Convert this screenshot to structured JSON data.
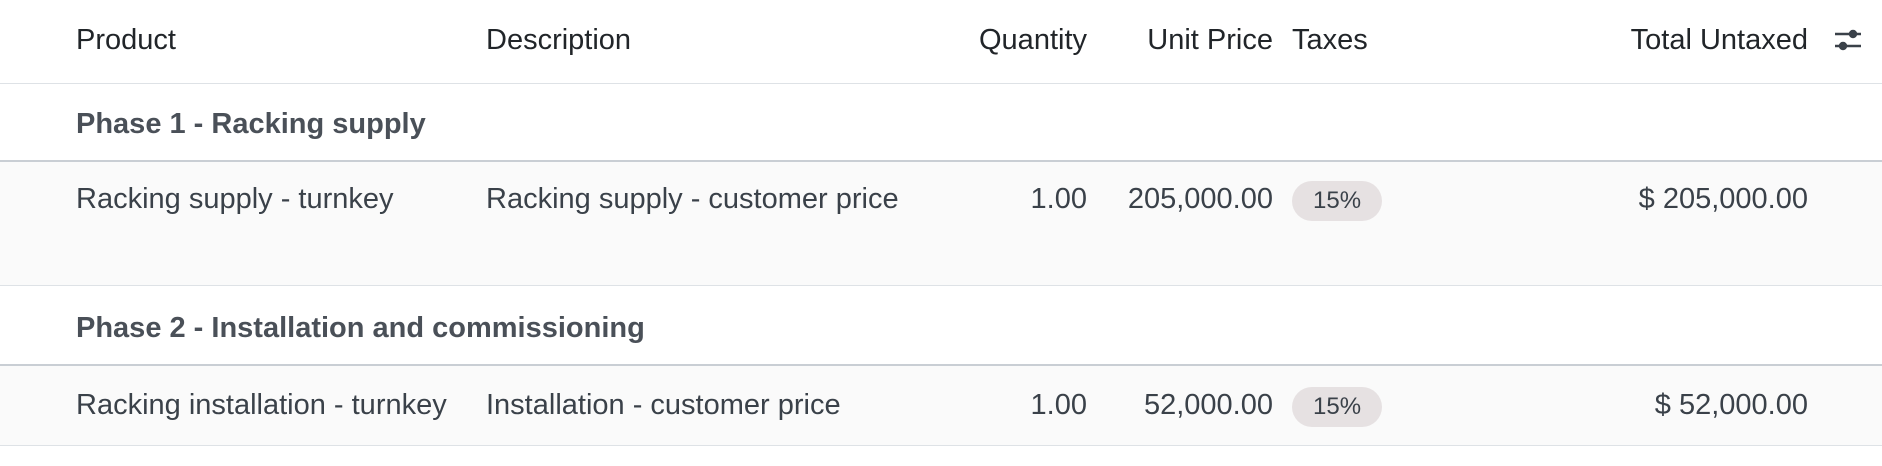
{
  "header": {
    "product": "Product",
    "description": "Description",
    "quantity": "Quantity",
    "unit_price": "Unit Price",
    "taxes": "Taxes",
    "total_untaxed": "Total Untaxed",
    "settings_icon": "optional-columns-sliders-icon"
  },
  "sections": [
    {
      "title": "Phase 1 - Racking supply",
      "lines": [
        {
          "product": "Racking supply - turnkey",
          "description": "Racking supply - customer price",
          "quantity": "1.00",
          "unit_price": "205,000.00",
          "tax": "15%",
          "total": "$ 205,000.00"
        }
      ]
    },
    {
      "title": "Phase 2 - Installation and commissioning",
      "lines": [
        {
          "product": "Racking installation - turnkey",
          "description": "Installation - customer price",
          "quantity": "1.00",
          "unit_price": "52,000.00",
          "tax": "15%",
          "total": "$ 52,000.00"
        }
      ]
    }
  ],
  "colors": {
    "header_text": "#212529",
    "body_text": "#3a4149",
    "line_background": "#fafafa",
    "badge_background": "#e6e1e2",
    "border": "#dee2e6"
  }
}
